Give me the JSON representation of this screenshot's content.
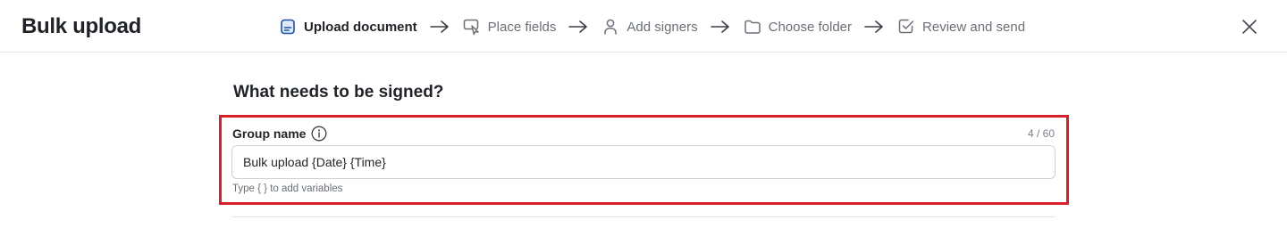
{
  "header": {
    "title": "Bulk upload",
    "close_icon": "close-icon",
    "steps": [
      {
        "label": "Upload document",
        "icon": "document-icon",
        "active": true
      },
      {
        "label": "Place fields",
        "icon": "place-fields-icon",
        "active": false
      },
      {
        "label": "Add signers",
        "icon": "person-icon",
        "active": false
      },
      {
        "label": "Choose folder",
        "icon": "folder-icon",
        "active": false
      },
      {
        "label": "Review and send",
        "icon": "check-square-icon",
        "active": false
      }
    ]
  },
  "main": {
    "section_title": "What needs to be signed?",
    "group_name": {
      "label": "Group name",
      "char_count": "4 / 60",
      "value": "Bulk upload {Date} {Time}",
      "helper": "Type { } to add variables"
    }
  },
  "colors": {
    "accent": "#1b4fa8",
    "highlight_border": "#d9202a",
    "text_primary": "#1f2328",
    "text_muted": "#6a6f78"
  }
}
